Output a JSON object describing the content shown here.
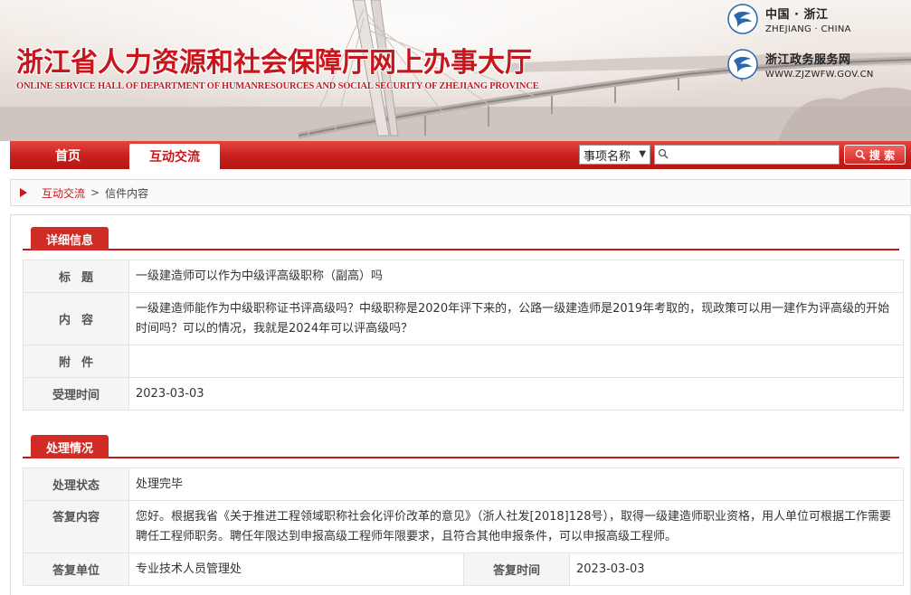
{
  "header": {
    "site_title": "浙江省人力资源和社会保障厅网上办事大厅",
    "site_subtitle": "ONLINE SERVICE HALL OF DEPARTMENT OF HUMANRESOURCES AND SOCIAL SECURITY OF ZHEJIANG PROVINCE",
    "links": [
      {
        "cn": "中国 · 浙江",
        "en": "ZHEJIANG · CHINA"
      },
      {
        "cn": "浙江政务服务网",
        "en": "WWW.ZJZWFW.GOV.CN"
      }
    ]
  },
  "nav": {
    "home": "首页",
    "active": "互动交流",
    "search_select": "事项名称",
    "search_button": "搜 索",
    "search_placeholder": ""
  },
  "breadcrumb": {
    "link": "互动交流",
    "separator": ">",
    "current": "信件内容"
  },
  "detail": {
    "heading": "详细信息",
    "rows": [
      {
        "label": "标题",
        "value": "一级建造师可以作为中级评高级职称（副高）吗"
      },
      {
        "label": "内容",
        "value": "一级建造师能作为中级职称证书评高级吗？中级职称是2020年评下来的，公路一级建造师是2019年考取的，现政策可以用一建作为评高级的开始时间吗？可以的情况，我就是2024年可以评高级吗？"
      },
      {
        "label": "附件",
        "value": ""
      },
      {
        "label": "受理时间",
        "value": "2023-03-03"
      }
    ]
  },
  "processing": {
    "heading": "处理情况",
    "status_label": "处理状态",
    "status_value": "处理完毕",
    "reply_label": "答复内容",
    "reply_value": "您好。根据我省《关于推进工程领域职称社会化评价改革的意见》（浙人社发[2018]128号），取得一级建造师职业资格，用人单位可根据工作需要聘任工程师职务。聘任年限达到申报高级工程师年限要求，且符合其他申报条件，可以申报高级工程师。",
    "unit_label": "答复单位",
    "unit_value": "专业技术人员管理处",
    "time_label": "答复时间",
    "time_value": "2023-03-03"
  },
  "colors": {
    "brand_red": "#c8161d",
    "nav_red": "#d12b25"
  }
}
